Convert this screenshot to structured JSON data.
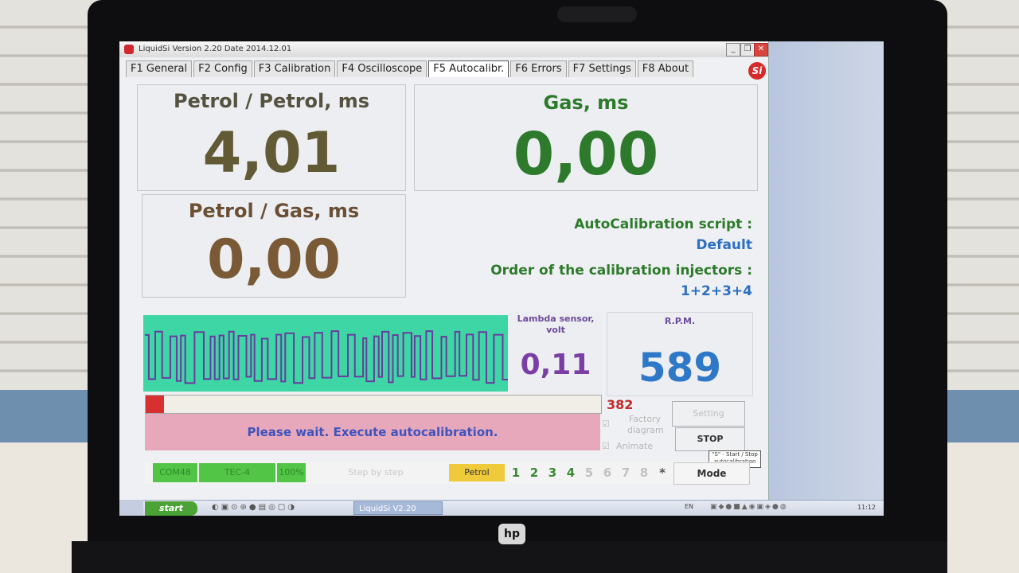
{
  "window": {
    "title": "LiquidSi  Version 2.20  Date 2014.12.01",
    "minimize": "_",
    "restore": "❐",
    "close": "✕"
  },
  "tabs": [
    {
      "label": "F1 General"
    },
    {
      "label": "F2 Config"
    },
    {
      "label": "F3 Calibration"
    },
    {
      "label": "F4 Oscilloscope"
    },
    {
      "label": "F5 Autocalibr.",
      "active": true
    },
    {
      "label": "F6 Errors"
    },
    {
      "label": "F7 Settings"
    },
    {
      "label": "F8 About"
    }
  ],
  "logo": {
    "text": "Si"
  },
  "petrol_petrol": {
    "label": "Petrol / Petrol, ms",
    "value": "4,01",
    "color": "#625a35"
  },
  "gas": {
    "label": "Gas,  ms",
    "value": "0,00",
    "color": "#2e7a2c"
  },
  "petrol_gas": {
    "label": "Petrol / Gas,  ms",
    "value": "0,00",
    "color": "#7a5a36"
  },
  "autocal": {
    "script_label": "AutoCalibration script :",
    "script_value": "Default",
    "order_label": "Order of the calibration injectors :",
    "order_value": "1+2+3+4",
    "label_color": "#2e7a2c",
    "value_color": "#2d6fc2"
  },
  "lambda": {
    "label": "Lambda sensor, volt",
    "value": "0,11",
    "color": "#7b3ea5",
    "wave_color": "#3ed6a4",
    "trace_color": "#6a3aa0"
  },
  "rpm": {
    "label": "R.P.M.",
    "value": "589",
    "color": "#2f78c8"
  },
  "progress": {
    "fraction": 0.04,
    "count": "382"
  },
  "status_message": "Please wait. Execute autocalibration.",
  "options": {
    "factory_diagram": "Factory diagram",
    "animate": "Animate"
  },
  "buttons": {
    "setting": "Setting",
    "stop": "STOP",
    "tooltip": "\"S\" - Start / Stop autocalibration"
  },
  "status_bar": {
    "port": "COM48",
    "ecu": "TEC-4",
    "percent": "100%",
    "step": "Step by step",
    "fuel": "Petrol",
    "cylinders": [
      "1",
      "2",
      "3",
      "4",
      "5",
      "6",
      "7",
      "8",
      "*"
    ],
    "mode": "Mode"
  },
  "taskbar": {
    "start": "start",
    "task": "LiquidSi  V2.20",
    "lang": "EN",
    "time": "11:12"
  },
  "brand": {
    "laptop": "hp"
  }
}
